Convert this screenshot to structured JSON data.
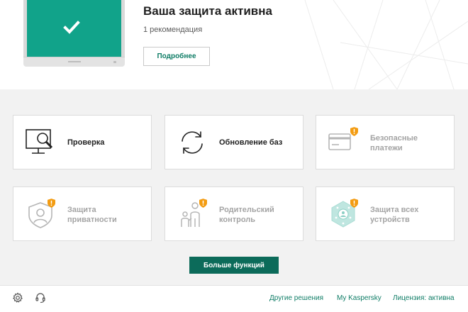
{
  "status": {
    "title": "Ваша защита активна",
    "subtitle": "1 рекомендация",
    "details_button": "Подробнее"
  },
  "tiles": [
    {
      "label": "Проверка",
      "icon": "scan-monitor-icon",
      "enabled": true
    },
    {
      "label": "Обновление баз",
      "icon": "refresh-arrows-icon",
      "enabled": true
    },
    {
      "label_lines": [
        "Безопасные",
        "платежи"
      ],
      "icon": "safe-payment-card-icon",
      "enabled": false,
      "badge": "shield-badge-icon"
    },
    {
      "label_lines": [
        "Защита",
        "приватности"
      ],
      "icon": "privacy-shield-icon",
      "enabled": false,
      "badge": "shield-badge-icon"
    },
    {
      "label_lines": [
        "Родительский",
        "контроль"
      ],
      "icon": "parental-control-icon",
      "enabled": false,
      "badge": "shield-badge-icon"
    },
    {
      "label_lines": [
        "Защита всех",
        "устройств"
      ],
      "icon": "all-devices-hexagon-icon",
      "enabled": false,
      "badge": "shield-badge-icon"
    }
  ],
  "more_button": "Больше функций",
  "footer": {
    "icons": [
      "settings-gear-icon",
      "support-headset-icon"
    ],
    "links": [
      "Другие решения",
      "My Kaspersky",
      "Лицензия: активна"
    ]
  },
  "colors": {
    "accent": "#0f7d66",
    "screen_green": "#11a38a",
    "button_dark_green": "#0c6b5a",
    "badge_orange": "#f39c12",
    "disabled_text": "#a4a4a4",
    "background": "#f2f2f2"
  }
}
